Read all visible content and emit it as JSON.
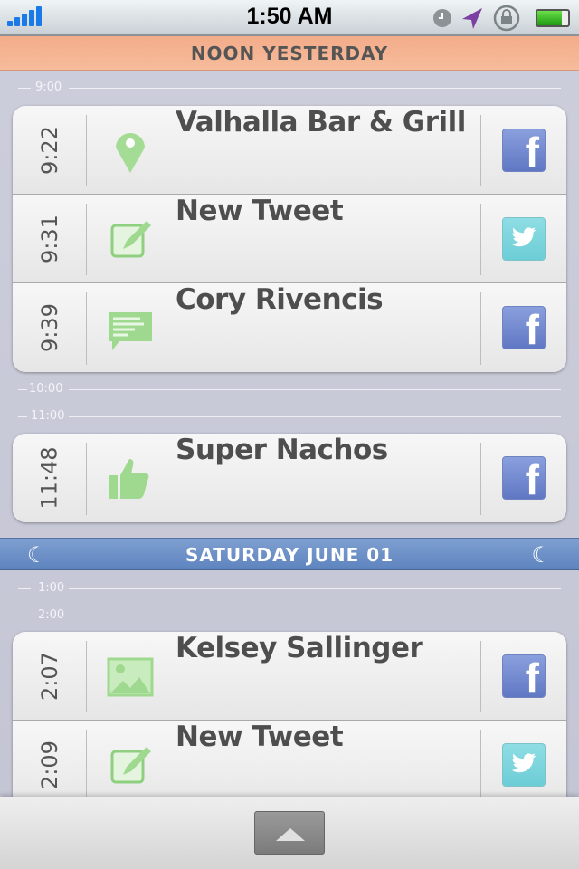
{
  "status_bar": {
    "time": "1:50 AM",
    "signal_bars": 5,
    "icons": [
      "signal-icon",
      "clock-icon",
      "location-arrow-icon",
      "rotation-lock-icon",
      "battery-icon"
    ],
    "battery_level": 0.85
  },
  "sections": [
    {
      "header": "NOON  YESTERDAY",
      "header_color": "#f5b493"
    },
    {
      "header": "SATURDAY  JUNE 01",
      "header_color": "#6f92c8"
    }
  ],
  "hours": [
    "9:00",
    "10:00",
    "11:00",
    "1:00",
    "2:00"
  ],
  "entries": [
    {
      "time": "9:22",
      "title": "Valhalla Bar & Grill",
      "icon": "map-pin-icon",
      "service": "facebook"
    },
    {
      "time": "9:31",
      "title": "New Tweet",
      "icon": "compose-icon",
      "service": "twitter"
    },
    {
      "time": "9:39",
      "title": "Cory Rivencis",
      "icon": "message-icon",
      "service": "facebook"
    },
    {
      "time": "11:48",
      "title": "Super Nachos",
      "icon": "thumbs-up-icon",
      "service": "facebook"
    },
    {
      "time": "2:07",
      "title": "Kelsey Sallinger",
      "icon": "photo-icon",
      "service": "facebook"
    },
    {
      "time": "2:09",
      "title": "New Tweet",
      "icon": "compose-icon",
      "service": "twitter"
    }
  ],
  "fb_glyph": "f",
  "moon_glyph": "☾",
  "colors": {
    "facebook": "#6f86cf",
    "twitter": "#7dd5dd",
    "icon_green": "#9fd88f"
  }
}
